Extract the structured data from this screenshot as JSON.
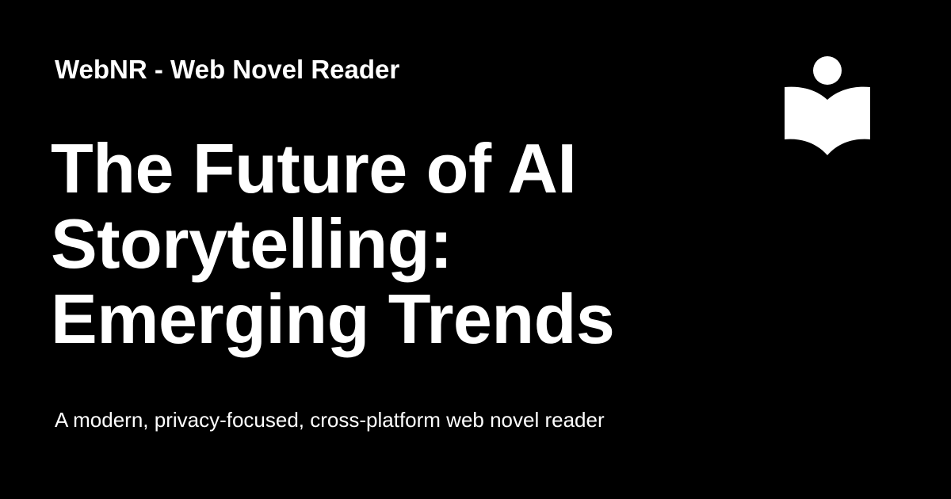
{
  "site": {
    "name": "WebNR - Web Novel Reader"
  },
  "article": {
    "title_lines": [
      "The Future of AI",
      "Storytelling:",
      "Emerging Trends"
    ]
  },
  "tagline": "A modern, privacy-focused, cross-platform web novel reader",
  "logo": {
    "icon": "book-reader-icon"
  },
  "colors": {
    "background": "#000000",
    "foreground": "#ffffff"
  }
}
